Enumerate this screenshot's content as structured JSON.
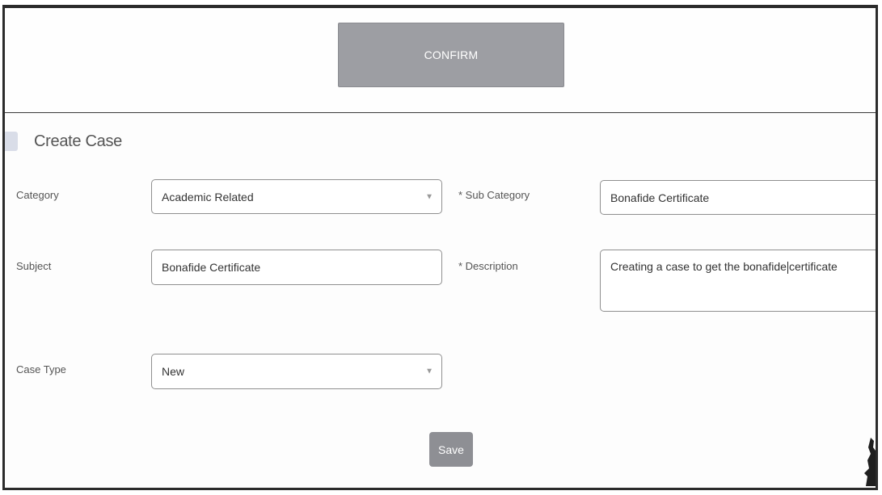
{
  "header": {
    "confirm_label": "CONFIRM"
  },
  "form": {
    "title": "Create Case",
    "category": {
      "label": "Category",
      "value": "Academic Related"
    },
    "sub_category": {
      "label": "* Sub Category",
      "value": "Bonafide Certificate"
    },
    "subject": {
      "label": "Subject",
      "value": "Bonafide Certificate"
    },
    "description": {
      "label": "* Description",
      "value_before_cursor": "Creating a case to get the bonafide",
      "value_after_cursor": "certificate"
    },
    "case_type": {
      "label": "Case Type",
      "value": "New"
    },
    "save_label": "Save"
  },
  "icons": {
    "case": "case-icon",
    "dropdown": "chevron-down-icon"
  },
  "colors": {
    "button_gray": "#9d9ea3",
    "save_gray": "#8e8f94",
    "text": "#555555"
  }
}
